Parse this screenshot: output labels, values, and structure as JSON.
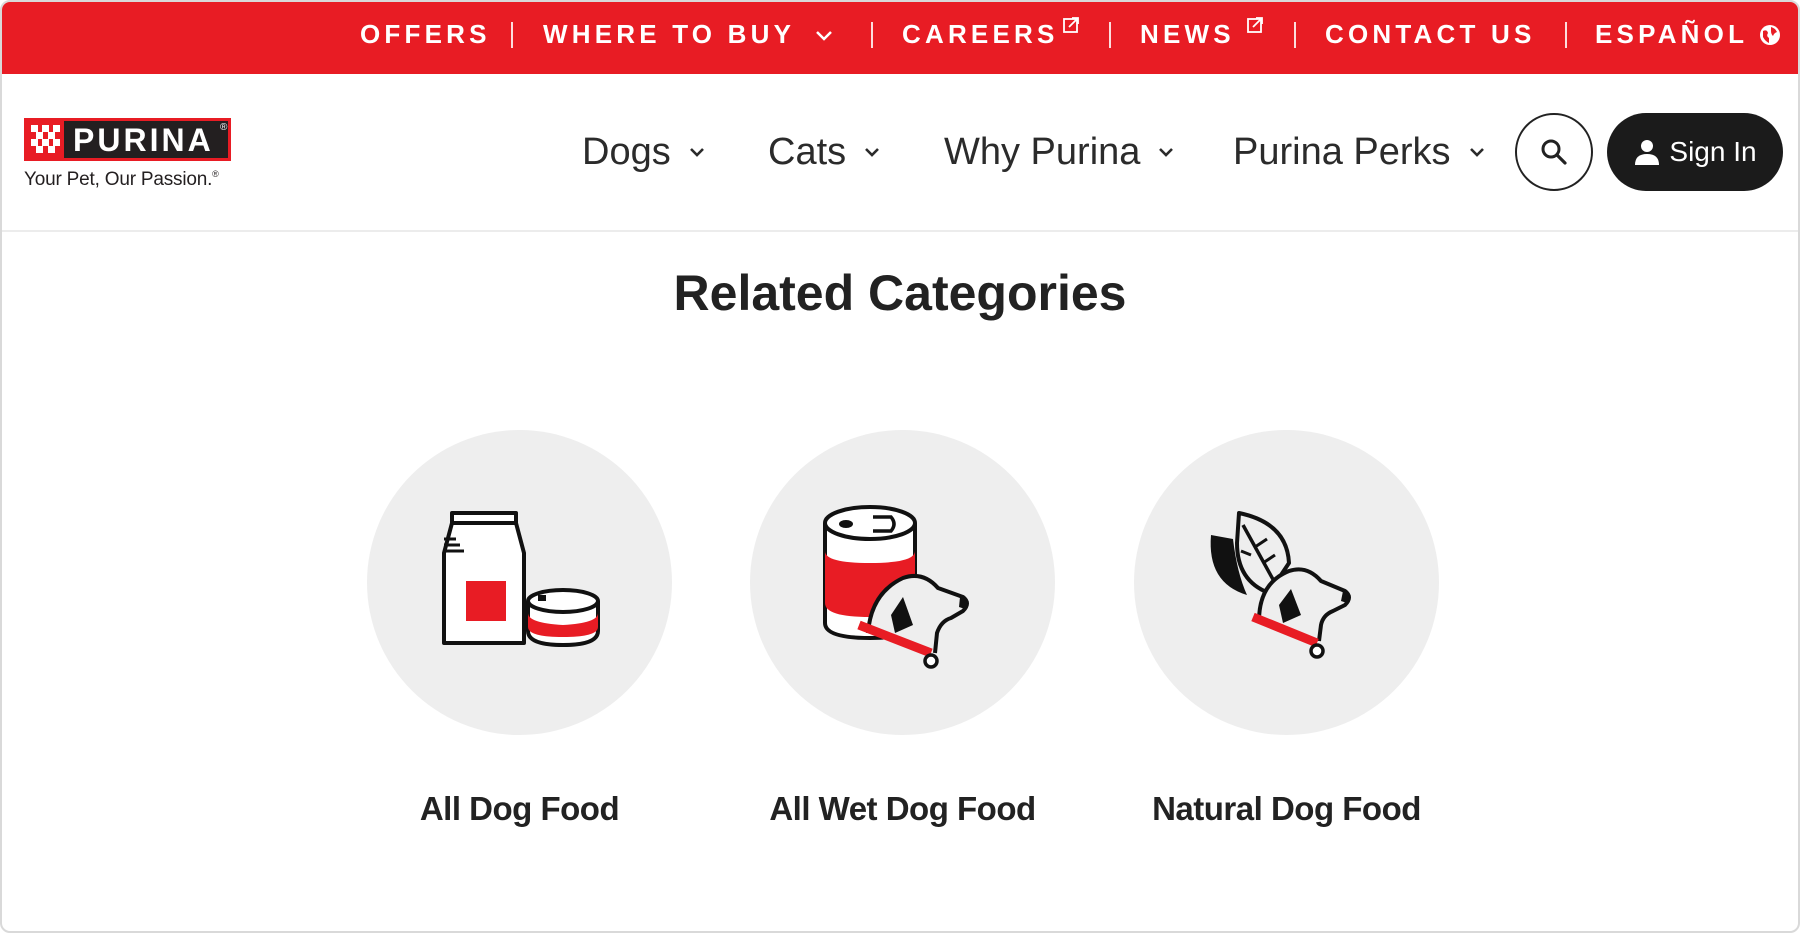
{
  "utility_nav": {
    "items": [
      {
        "label": "OFFERS",
        "icon": null
      },
      {
        "label": "WHERE TO BUY",
        "icon": "chevron-down-icon"
      },
      {
        "label": "CAREERS",
        "icon": "external-link-icon"
      },
      {
        "label": "NEWS",
        "icon": "external-link-icon"
      },
      {
        "label": "CONTACT US",
        "icon": null
      },
      {
        "label": "ESPAÑOL",
        "icon": "globe-icon"
      }
    ]
  },
  "brand": {
    "name": "PURINA",
    "registered_mark": "®",
    "tagline": "Your Pet, Our Passion.",
    "tagline_mark": "®"
  },
  "main_nav": {
    "items": [
      {
        "label": "Dogs"
      },
      {
        "label": "Cats"
      },
      {
        "label": "Why Purina"
      },
      {
        "label": "Purina Perks"
      }
    ],
    "search_icon": "search-icon",
    "sign_in_label": "Sign In"
  },
  "related": {
    "title": "Related Categories",
    "categories": [
      {
        "label": "All Dog Food",
        "icon": "dry-and-wet-food-icon"
      },
      {
        "label": "All Wet Dog Food",
        "icon": "wet-food-can-dog-icon"
      },
      {
        "label": "Natural Dog Food",
        "icon": "leaf-dog-icon"
      }
    ]
  },
  "colors": {
    "brand_red": "#E81C24",
    "dark": "#1b1b1b",
    "circle_bg": "#eeeeee"
  }
}
